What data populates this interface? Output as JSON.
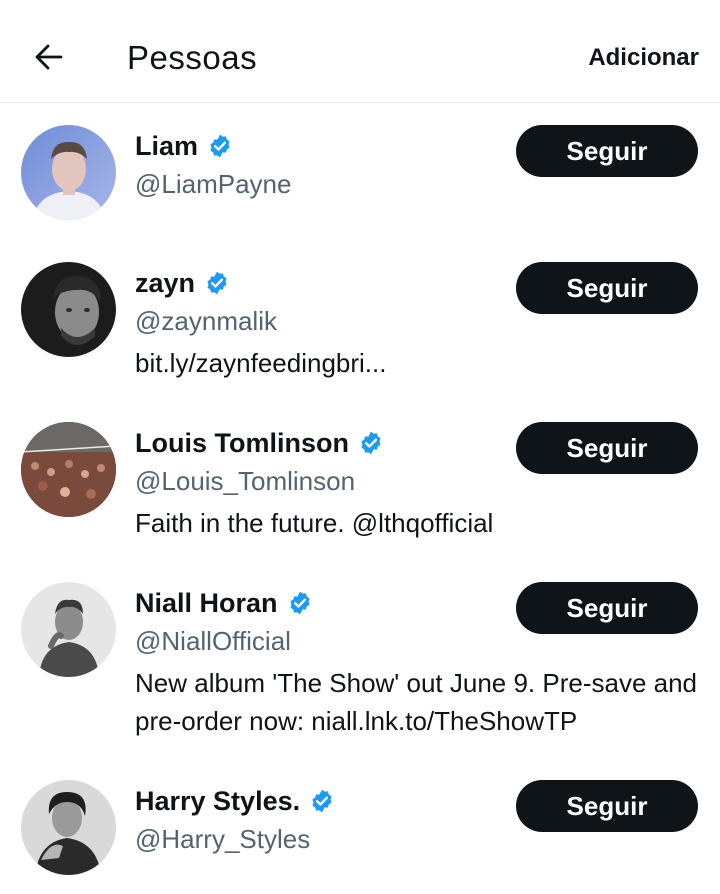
{
  "header": {
    "title": "Pessoas",
    "add_label": "Adicionar",
    "back_icon": "arrow-left-icon"
  },
  "colors": {
    "text_primary": "#0f1419",
    "text_secondary": "#536471",
    "verified_blue": "#1d9bf0",
    "button_bg": "#0f1419",
    "button_text": "#ffffff",
    "divider": "#e6e8ea"
  },
  "users": [
    {
      "name": "Liam",
      "handle": "@LiamPayne",
      "bio": "",
      "verified": true,
      "follow_label": "Seguir"
    },
    {
      "name": "zayn",
      "handle": "@zaynmalik",
      "bio": "bit.ly/zaynfeedingbri...",
      "verified": true,
      "follow_label": "Seguir"
    },
    {
      "name": "Louis Tomlinson",
      "handle": "@Louis_Tomlinson",
      "bio": "Faith in the future. @lthqofficial",
      "verified": true,
      "follow_label": "Seguir"
    },
    {
      "name": "Niall Horan",
      "handle": "@NiallOfficial",
      "bio": "New album 'The Show' out June 9. Pre-save and pre-order now: niall.lnk.to/TheShowTP",
      "verified": true,
      "follow_label": "Seguir"
    },
    {
      "name": "Harry Styles.",
      "handle": "@Harry_Styles",
      "bio": "",
      "verified": true,
      "follow_label": "Seguir"
    }
  ]
}
